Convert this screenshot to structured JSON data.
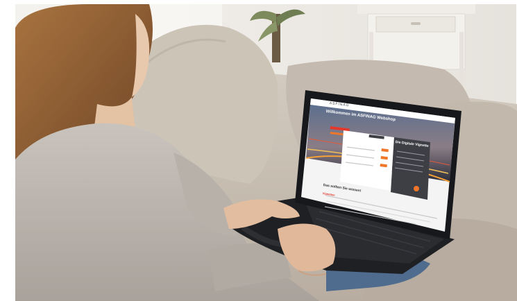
{
  "scene": {
    "laptop_screen": {
      "brand": "ASFINAG",
      "hero_title": "Willkommen im ASFINAG Webshop",
      "panel_title": "Die Digitale Vignette",
      "section_heading": "Das sollten Sie wissen!",
      "footer_brand": "Vignetten"
    }
  },
  "colors": {
    "sofa": "#c9bfb3",
    "sweater": "#bdb6b0",
    "hair": "#8a5a34",
    "laptop": "#1c1d20",
    "accent": "#f0772a",
    "panel": "#3d3f45",
    "wall": "#ece9e4"
  }
}
